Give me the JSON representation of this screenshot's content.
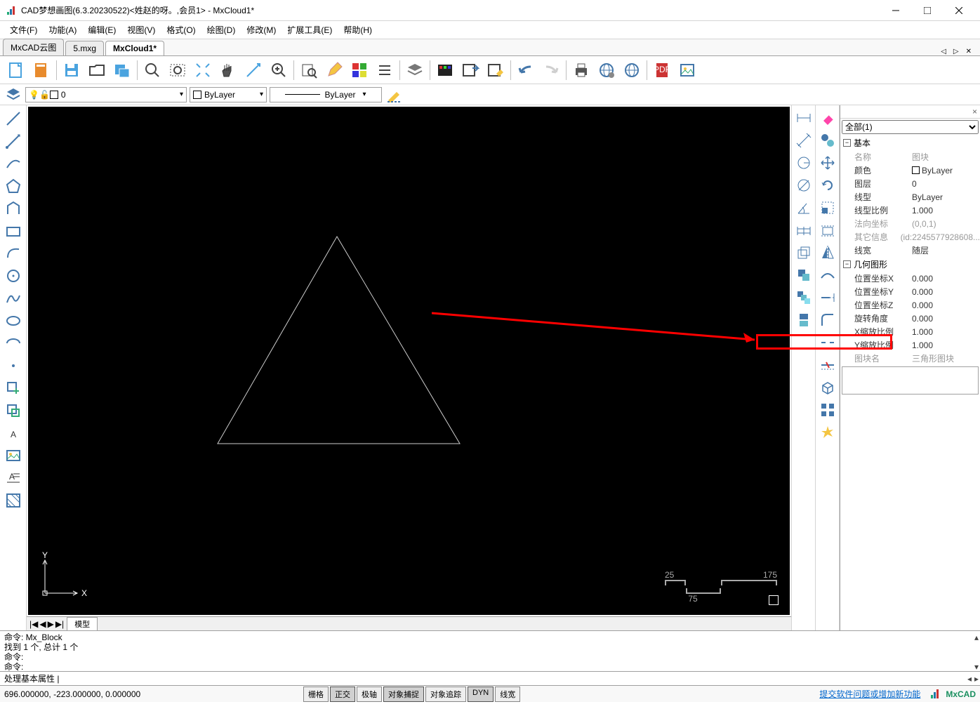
{
  "titlebar": {
    "title": "CAD梦想画图(6.3.20230522)<姓赵的呀。,会员1> - MxCloud1*"
  },
  "menu": [
    "文件(F)",
    "功能(A)",
    "编辑(E)",
    "视图(V)",
    "格式(O)",
    "绘图(D)",
    "修改(M)",
    "扩展工具(E)",
    "帮助(H)"
  ],
  "tabs": {
    "items": [
      "MxCAD云图",
      "5.mxg",
      "MxCloud1*"
    ],
    "active": 2
  },
  "layerbar": {
    "layer": "0",
    "color": "ByLayer",
    "linetype": "ByLayer"
  },
  "sheet_tab": "模型",
  "canvas": {
    "ucs_y": "Y",
    "ucs_x": "X",
    "scale_a": "25",
    "scale_b": "75",
    "scale_c": "175"
  },
  "props": {
    "selector": "全部(1)",
    "sec1": "基本",
    "sec2": "几何图形",
    "rows1": [
      {
        "k": "名称",
        "v": "图块",
        "dim": true
      },
      {
        "k": "颜色",
        "v": "ByLayer",
        "swatch": true
      },
      {
        "k": "图层",
        "v": "0"
      },
      {
        "k": "线型",
        "v": "ByLayer"
      },
      {
        "k": "线型比例",
        "v": "1.000"
      },
      {
        "k": "法向坐标",
        "v": "(0,0,1)",
        "dim": true
      },
      {
        "k": "其它信息",
        "v": "(id:2245577928608...",
        "dim": true
      },
      {
        "k": "线宽",
        "v": "随层"
      }
    ],
    "rows2": [
      {
        "k": "位置坐标X",
        "v": "0.000"
      },
      {
        "k": "位置坐标Y",
        "v": "0.000"
      },
      {
        "k": "位置坐标Z",
        "v": "0.000"
      },
      {
        "k": "旋转角度",
        "v": "0.000"
      },
      {
        "k": "X缩放比例",
        "v": "1.000"
      },
      {
        "k": "Y缩放比例",
        "v": "1.000"
      },
      {
        "k": "图块名",
        "v": "三角形图块",
        "dim": true
      }
    ]
  },
  "cmd": {
    "l1": "命令: Mx_Block",
    "l2": "    找到 1 个, 总计 1 个",
    "l3": "命令:",
    "l4": "命令:",
    "input": "处理基本属性 |"
  },
  "status": {
    "coords": "696.000000,  -223.000000,  0.000000",
    "btns": [
      {
        "t": "栅格",
        "on": false
      },
      {
        "t": "正交",
        "on": true
      },
      {
        "t": "极轴",
        "on": false
      },
      {
        "t": "对象捕捉",
        "on": true
      },
      {
        "t": "对象追踪",
        "on": false
      },
      {
        "t": "DYN",
        "on": true
      },
      {
        "t": "线宽",
        "on": false
      }
    ],
    "link": "提交软件问题或增加新功能",
    "brand": "MxCAD"
  }
}
